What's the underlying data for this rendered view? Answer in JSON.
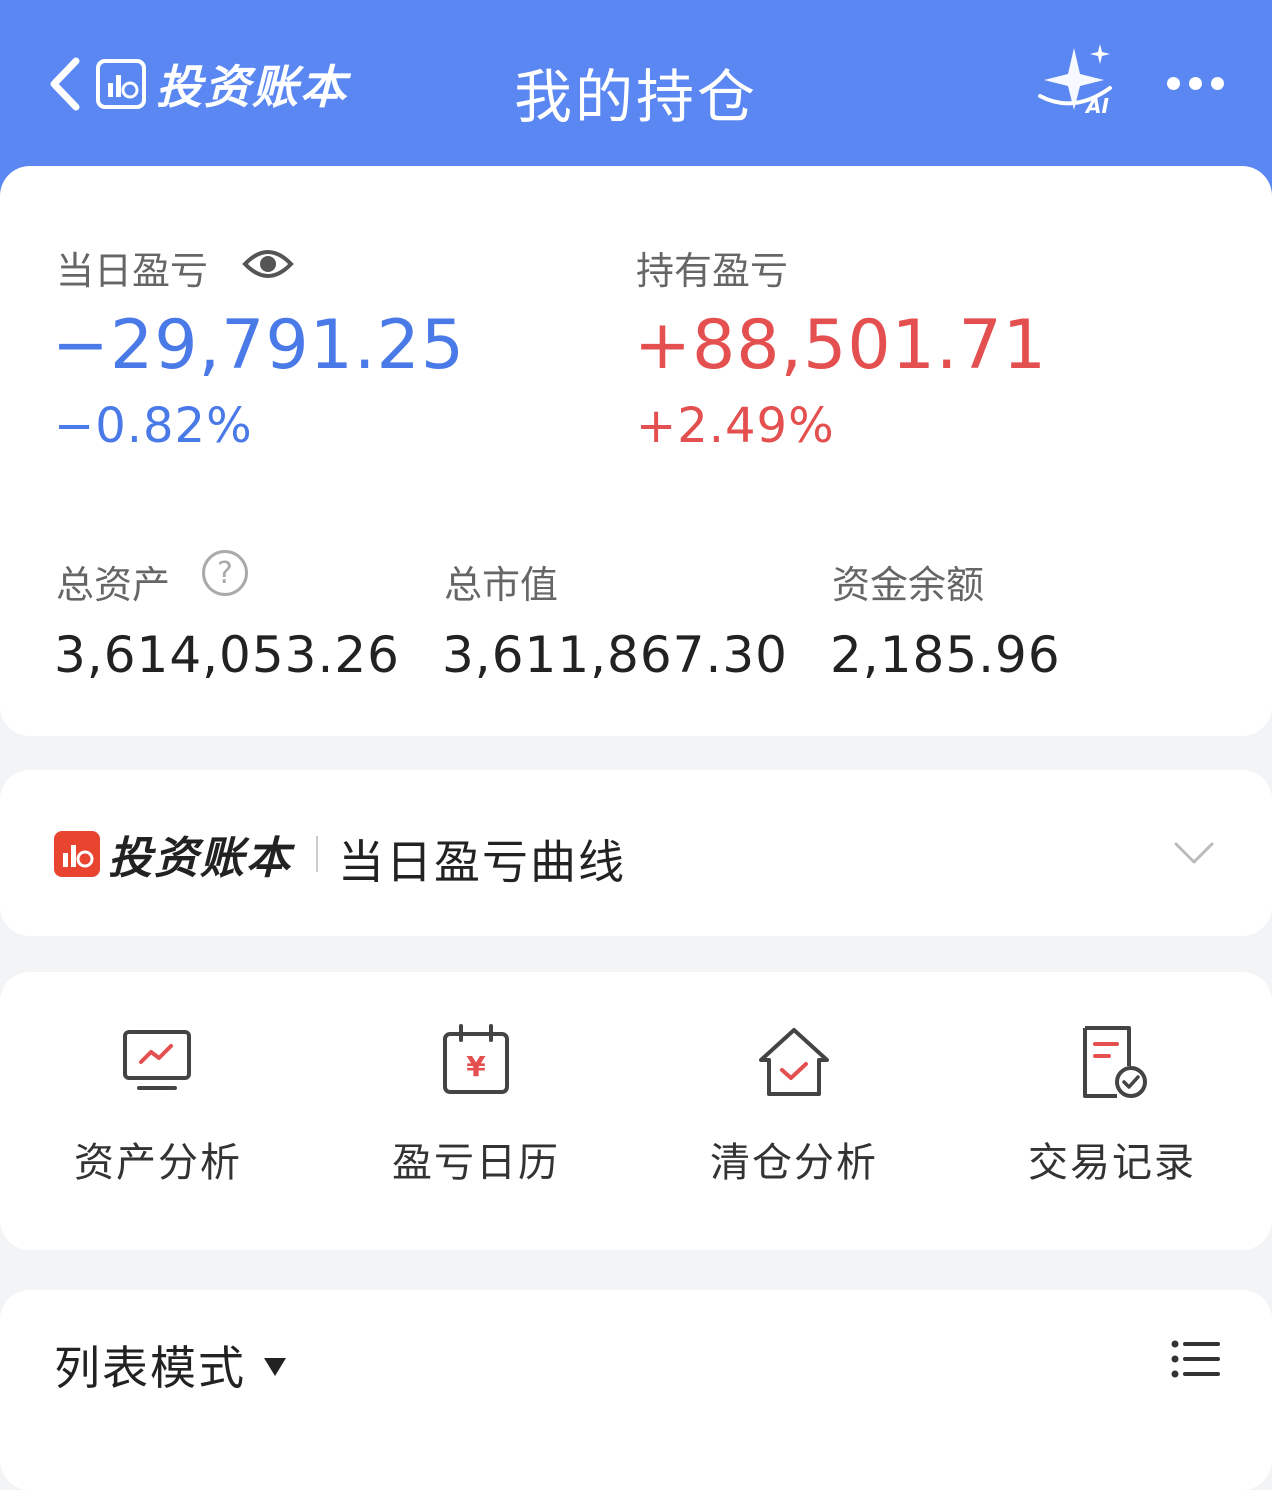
{
  "header": {
    "brand": "投资账本",
    "title": "我的持仓",
    "ai_label": "AI"
  },
  "summary": {
    "daily_pl": {
      "label": "当日盈亏",
      "value": "−29,791.25",
      "percent": "−0.82%"
    },
    "holding_pl": {
      "label": "持有盈亏",
      "value": "+88,501.71",
      "percent": "+2.49%"
    },
    "total_assets": {
      "label": "总资产",
      "value": "3,614,053.26"
    },
    "market_value": {
      "label": "总市值",
      "value": "3,611,867.30"
    },
    "cash_balance": {
      "label": "资金余额",
      "value": "2,185.96"
    },
    "help_glyph": "?"
  },
  "curve": {
    "brand": "投资账本",
    "title": "当日盈亏曲线"
  },
  "tools": [
    {
      "label": "资产分析",
      "icon": "monitor-chart-icon"
    },
    {
      "label": "盈亏日历",
      "icon": "calendar-yuan-icon"
    },
    {
      "label": "清仓分析",
      "icon": "house-check-icon"
    },
    {
      "label": "交易记录",
      "icon": "document-check-icon"
    }
  ],
  "list": {
    "mode_label": "列表模式"
  },
  "colors": {
    "header_bg": "#5b87f2",
    "negative": "#4a7ae8",
    "positive": "#e44f4f",
    "brand_red": "#e8442f"
  }
}
